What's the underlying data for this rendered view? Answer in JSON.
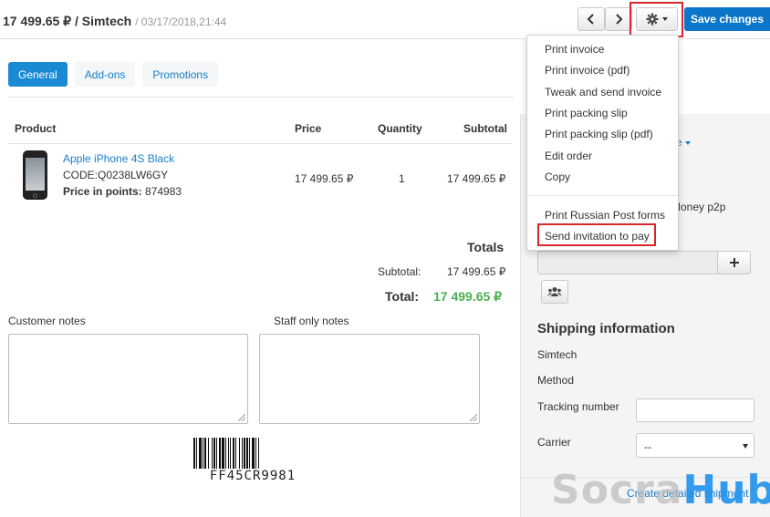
{
  "header": {
    "order_label": "17 499.65 ₽ / Simtech",
    "date": "/ 03/17/2018,21:44",
    "save_label": "Save changes"
  },
  "tabs": [
    {
      "label": "General"
    },
    {
      "label": "Add-ons"
    },
    {
      "label": "Promotions"
    }
  ],
  "products": {
    "headers": {
      "product": "Product",
      "price": "Price",
      "quantity": "Quantity",
      "subtotal": "Subtotal"
    },
    "item": {
      "name": "Apple iPhone 4S Black",
      "code": "CODE:Q0238LW6GY",
      "points_label": "Price in points:",
      "points_value": "874983",
      "price": "17 499.65 ₽",
      "quantity": "1",
      "subtotal": "17 499.65 ₽"
    }
  },
  "totals": {
    "heading": "Totals",
    "subtotal_label": "Subtotal:",
    "subtotal_value": "17 499.65 ₽",
    "total_label": "Total:",
    "total_value": "17 499.65 ₽",
    "total_color": "#4caf50"
  },
  "notes": {
    "customer_label": "Customer notes",
    "staff_label": "Staff only notes"
  },
  "barcode": {
    "code": "FF45CR9981"
  },
  "sidebar": {
    "partial_link": "e",
    "partial_payment": "Money p2p",
    "shipping_heading": "Shipping information",
    "shipping_company": "Simtech",
    "method_label": "Method",
    "tracking_label": "Tracking number",
    "carrier_label": "Carrier",
    "carrier_value": "--",
    "create_shipment_link": "Create detailed shipment"
  },
  "dropdown": {
    "items": [
      "Print invoice",
      "Print invoice (pdf)",
      "Tweak and send invoice",
      "Print packing slip",
      "Print packing slip (pdf)",
      "Edit order",
      "Copy"
    ],
    "items_bottom": [
      "Print Russian Post forms",
      "Send invitation to pay"
    ]
  },
  "watermark": {
    "part1": "Socra",
    "part2": "Hub"
  },
  "colors": {
    "accent": "#1a8ad4",
    "highlight": "#d9262c"
  }
}
